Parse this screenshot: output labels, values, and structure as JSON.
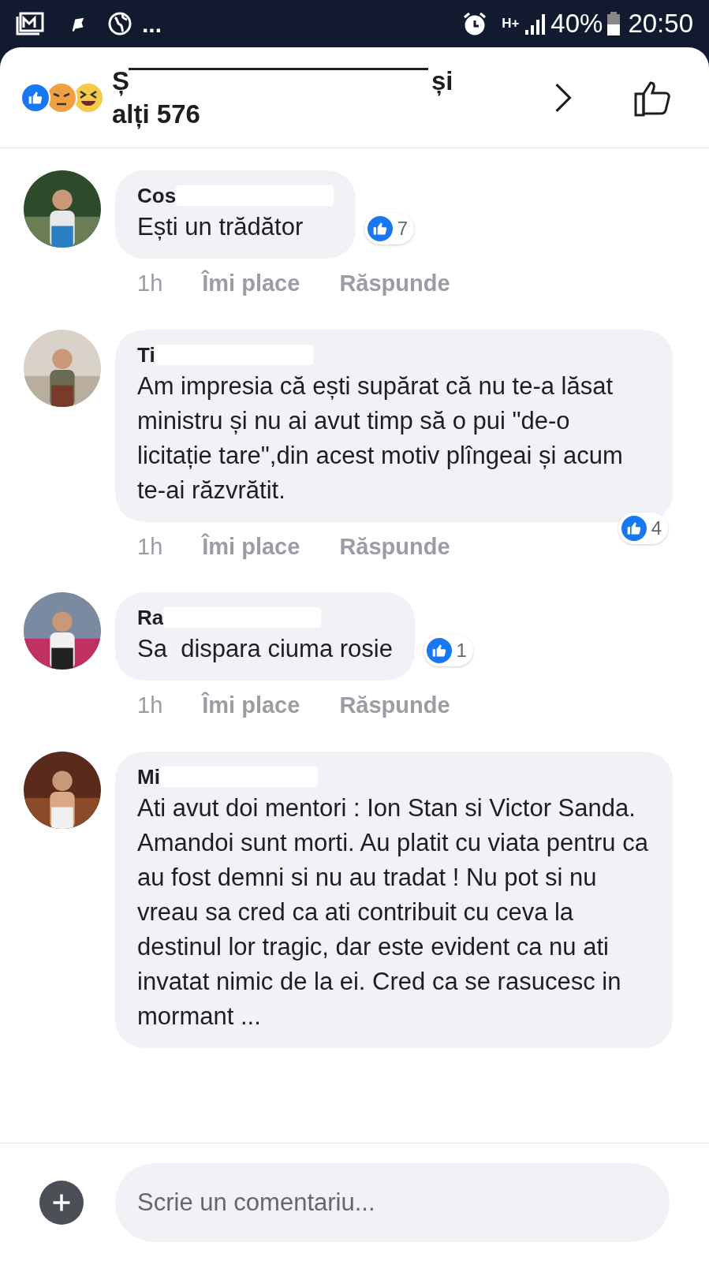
{
  "status_bar": {
    "more": "...",
    "battery": "40%",
    "network": "H+",
    "time": "20:50"
  },
  "header": {
    "name_start": "Ș",
    "name_end": "și",
    "others": "alți 576"
  },
  "comments": [
    {
      "name": "Cos",
      "text": "Ești un trădător",
      "reactions": "7",
      "time": "1h",
      "like": "Îmi place",
      "reply": "Răspunde"
    },
    {
      "name": "Ti",
      "text": "Am impresia că ești supărat că nu te-a lăsat ministru și nu ai avut timp să o pui \"de-o licitație tare\",din acest motiv plîngeai și acum te-ai răzvrătit.",
      "reactions": "4",
      "time": "1h",
      "like": "Îmi place",
      "reply": "Răspunde"
    },
    {
      "name": "Ra",
      "text": "Sa  dispara ciuma rosie",
      "reactions": "1",
      "time": "1h",
      "like": "Îmi place",
      "reply": "Răspunde"
    },
    {
      "name": "Mi",
      "text": "Ati avut doi mentori : Ion Stan si Victor Sanda. Amandoi sunt morti. Au platit cu viata pentru ca au fost demni si nu au tradat ! Nu pot si nu vreau sa cred ca ati contribuit cu ceva la destinul lor tragic, dar este evident ca nu ati invatat nimic de la ei. Cred ca se rasucesc in mormant ..."
    }
  ],
  "composer": {
    "placeholder": "Scrie un comentariu..."
  }
}
